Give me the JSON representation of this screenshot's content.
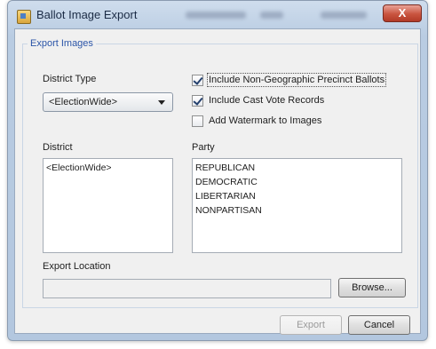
{
  "window": {
    "title": "Ballot Image Export",
    "close_label": "X"
  },
  "group": {
    "label": "Export Images"
  },
  "district_type": {
    "label": "District Type",
    "selected": "<ElectionWide>"
  },
  "options": {
    "include_non_geo": {
      "label": "Include Non-Geographic Precinct Ballots",
      "checked": true
    },
    "include_cvr": {
      "label": "Include Cast Vote Records",
      "checked": true
    },
    "add_watermark": {
      "label": "Add Watermark to Images",
      "checked": false
    }
  },
  "district": {
    "label": "District",
    "items": [
      "<ElectionWide>"
    ]
  },
  "party": {
    "label": "Party",
    "items": [
      "REPUBLICAN",
      "DEMOCRATIC",
      "LIBERTARIAN",
      "NONPARTISAN"
    ]
  },
  "export_location": {
    "label": "Export Location",
    "value": "",
    "browse_label": "Browse..."
  },
  "footer": {
    "export_label": "Export",
    "cancel_label": "Cancel"
  }
}
